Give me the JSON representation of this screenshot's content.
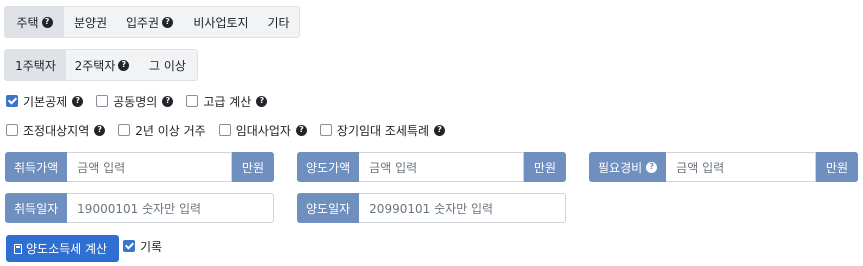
{
  "house_type_tabs": [
    {
      "label": "주택",
      "help": "?",
      "active": true
    },
    {
      "label": "분양권",
      "help": "",
      "active": false
    },
    {
      "label": "입주권",
      "help": "?",
      "active": false
    },
    {
      "label": "비사업토지",
      "help": "",
      "active": false
    },
    {
      "label": "기타",
      "help": "",
      "active": false
    }
  ],
  "house_count_tabs": [
    {
      "label": "1주택자",
      "help": "",
      "active": true
    },
    {
      "label": "2주택자",
      "help": "?",
      "active": false
    },
    {
      "label": "그 이상",
      "help": "",
      "active": false
    }
  ],
  "options_row1": [
    {
      "label": "기본공제",
      "help": "?",
      "checked": true
    },
    {
      "label": "공동명의",
      "help": "?",
      "checked": false
    },
    {
      "label": "고급 계산",
      "help": "?",
      "checked": false
    }
  ],
  "options_row2": [
    {
      "label": "조정대상지역",
      "help": "?",
      "checked": false
    },
    {
      "label": "2년 이상 거주",
      "help": "",
      "checked": false
    },
    {
      "label": "임대사업자",
      "help": "?",
      "checked": false
    },
    {
      "label": "장기임대 조세특례",
      "help": "?",
      "checked": false
    }
  ],
  "inputs": {
    "acquisition_price": {
      "label": "취득가액",
      "placeholder": "금액 입력",
      "unit": "만원"
    },
    "transfer_price": {
      "label": "양도가액",
      "placeholder": "금액 입력",
      "unit": "만원"
    },
    "expenses": {
      "label": "필요경비",
      "help": "?",
      "placeholder": "금액 입력",
      "unit": "만원"
    },
    "acquisition_date": {
      "label": "취득일자",
      "placeholder": "19000101 숫자만 입력"
    },
    "transfer_date": {
      "label": "양도일자",
      "placeholder": "20990101 숫자만 입력"
    }
  },
  "actions": {
    "calculate_label": "양도소득세 계산",
    "record_label": "기록",
    "record_checked": true
  },
  "colors": {
    "addon": "#6f8fbf",
    "primary_button": "#2f6fd2",
    "checkbox_checked": "#3b74c9",
    "active_tab": "#dfe3e8"
  }
}
